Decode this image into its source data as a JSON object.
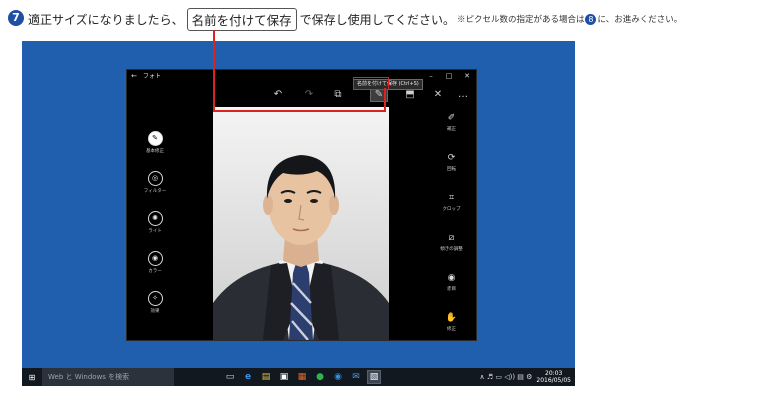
{
  "instruction": {
    "step": "7",
    "text_before": "適正サイズになりましたら、",
    "boxed_label": "名前を付けて保存",
    "text_after": "で保存し使用してください。",
    "note_prefix": "※ピクセル数の指定がある場合は",
    "note_step": "8",
    "note_suffix": "に、お進みください。"
  },
  "window": {
    "title": "フォト",
    "back": "←",
    "controls": {
      "minimize": "–",
      "maximize": "□",
      "close": "✕"
    }
  },
  "toolbar": {
    "undo": "↶",
    "redo": "↷",
    "compare": "⧉",
    "save_copy": "✎",
    "save": "⬒",
    "close": "✕",
    "more": "…",
    "tooltip": "名前を付けて保存 (Ctrl+S)"
  },
  "left_panel": {
    "items": [
      {
        "icon": "✎",
        "label": "基本修正"
      },
      {
        "icon": "◎",
        "label": "フィルター"
      },
      {
        "icon": "✺",
        "label": "ライト"
      },
      {
        "icon": "◉",
        "label": "カラー"
      },
      {
        "icon": "✧",
        "label": "効果"
      }
    ]
  },
  "right_panel": {
    "items": [
      {
        "icon": "✐",
        "label": "補正"
      },
      {
        "icon": "⟳",
        "label": "回転"
      },
      {
        "icon": "⌗",
        "label": "クロップ"
      },
      {
        "icon": "⧄",
        "label": "傾きの調整"
      },
      {
        "icon": "◉",
        "label": "赤目"
      },
      {
        "icon": "✋",
        "label": "修正"
      }
    ]
  },
  "taskbar": {
    "start": "⊞",
    "search_placeholder": "Web と Windows を検索",
    "apps": [
      "▭",
      "e",
      "▤",
      "▣",
      "▦",
      "●",
      "◉",
      "✉",
      "▧"
    ],
    "tray": "∧ ♬ ▭ ◁)) ▤ ⚙",
    "time": "20:03",
    "date": "2016/05/05"
  },
  "colors": {
    "desktop": "#1f5fad",
    "accent_red": "#dd2222",
    "badge": "#1f4fa3"
  }
}
